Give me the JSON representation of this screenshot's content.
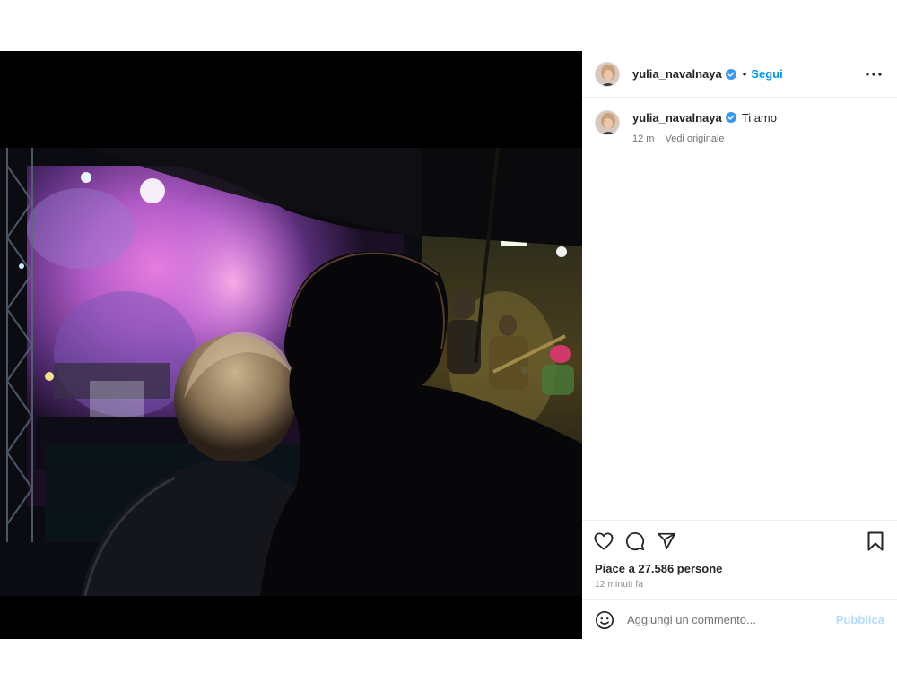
{
  "post": {
    "username": "yulia_navalnaya",
    "follow_label": "Segui",
    "separator": "•",
    "caption_text": "Ti amo",
    "caption_time": "12 m",
    "see_original": "Vedi originale",
    "likes_text": "Piace a 27.586 persone",
    "timestamp": "12 minuti fa",
    "comment_placeholder": "Aggiungi un commento...",
    "publish_label": "Pubblica"
  },
  "icons": {
    "verified": "verified-badge-icon",
    "more": "more-options-icon",
    "like": "heart-icon",
    "comment": "comment-bubble-icon",
    "share": "paper-plane-icon",
    "save": "bookmark-icon",
    "emoji": "smiley-face-icon"
  },
  "colors": {
    "accent": "#0095f6",
    "verified": "#3897f0",
    "publish_disabled": "#b3dbff",
    "media_bg": "#000000"
  }
}
